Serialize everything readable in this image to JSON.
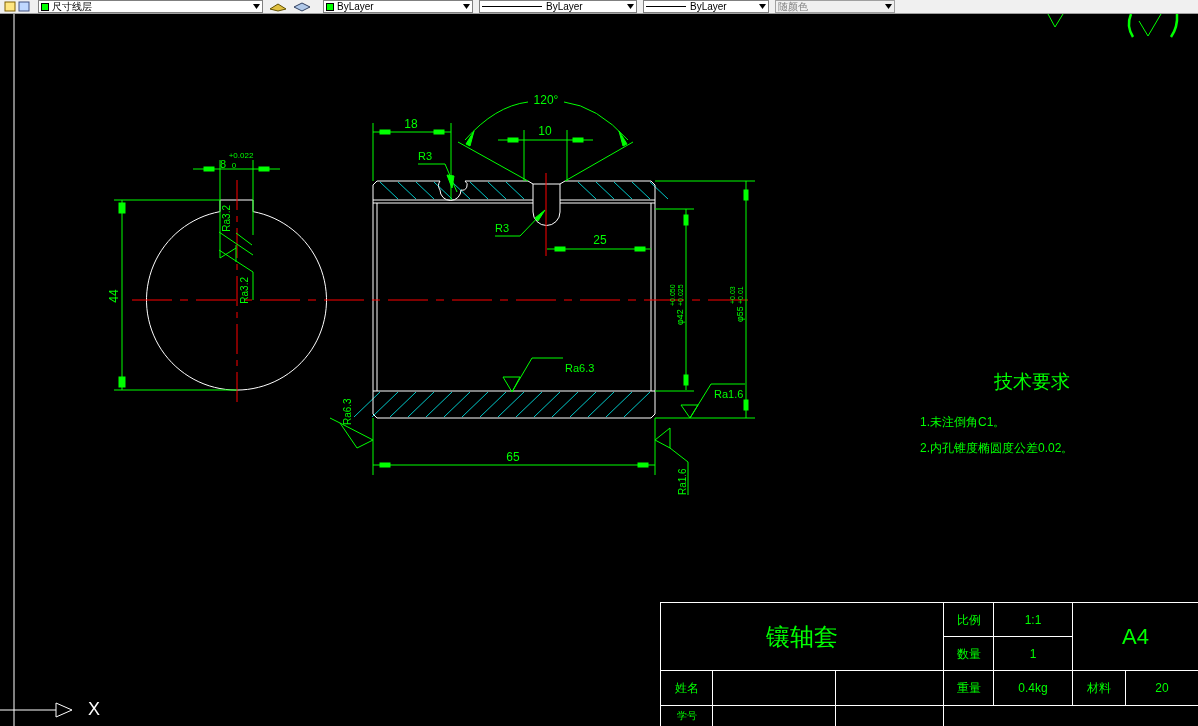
{
  "toolbar": {
    "layer": "尺寸线层",
    "color_setting": "ByLayer",
    "linetype": "ByLayer",
    "lineweight": "ByLayer",
    "plot_style": "随颜色"
  },
  "drawing": {
    "annotations": [
      {
        "text": "+0.022"
      },
      {
        "text": "8"
      },
      {
        "text": "0"
      },
      {
        "text": "Ra3.2"
      },
      {
        "text": "Ra3.2"
      },
      {
        "text": "44"
      },
      {
        "text": "18"
      },
      {
        "text": "120°"
      },
      {
        "text": "10"
      },
      {
        "text": "R3"
      },
      {
        "text": "R3"
      },
      {
        "text": "25"
      },
      {
        "text": "φ42"
      },
      {
        "text": "+0.050"
      },
      {
        "text": "+0.025"
      },
      {
        "text": "φ55"
      },
      {
        "text": "+0.03"
      },
      {
        "text": "+0.01"
      },
      {
        "text": "Ra6.3"
      },
      {
        "text": "Ra1.6"
      },
      {
        "text": "Ra6.3"
      },
      {
        "text": "65"
      },
      {
        "text": "Ra1.6"
      }
    ],
    "ucs_axis": "X"
  },
  "technical_requirements": {
    "title": "技术要求",
    "items": [
      "1.未注倒角C1。",
      "2.内孔锥度椭圆度公差0.02。"
    ]
  },
  "title_block": {
    "part_name": "镶轴套",
    "scale_label": "比例",
    "scale": "1:1",
    "sheet_size": "A4",
    "quantity_label": "数量",
    "quantity": "1",
    "name_label": "姓名",
    "weight_label": "重量",
    "weight": "0.4kg",
    "material_label": "材料",
    "material": "20",
    "student_id_label": "学号"
  }
}
